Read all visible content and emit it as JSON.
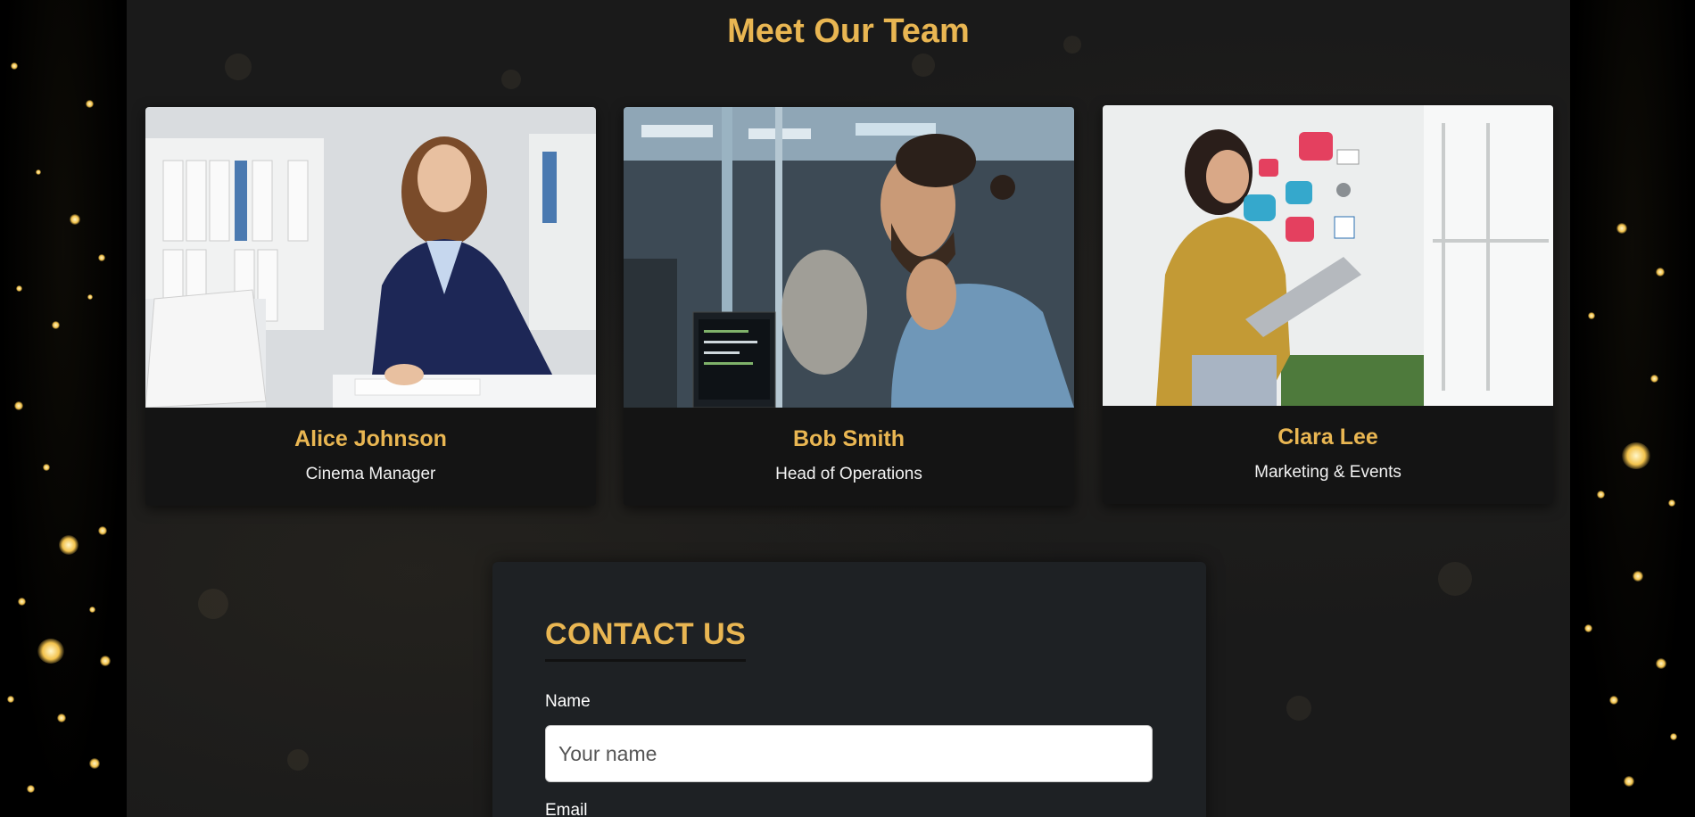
{
  "team": {
    "title": "Meet Our Team",
    "members": [
      {
        "name": "Alice Johnson",
        "role": "Cinema Manager"
      },
      {
        "name": "Bob Smith",
        "role": "Head of Operations"
      },
      {
        "name": "Clara Lee",
        "role": "Marketing & Events"
      }
    ]
  },
  "contact": {
    "title": "CONTACT US",
    "name_label": "Name",
    "name_placeholder": "Your name",
    "email_label": "Email"
  },
  "colors": {
    "accent": "#e9b652",
    "page_bg": "#1a1a1a",
    "card_bg": "#141414",
    "form_bg": "#1e2124"
  }
}
